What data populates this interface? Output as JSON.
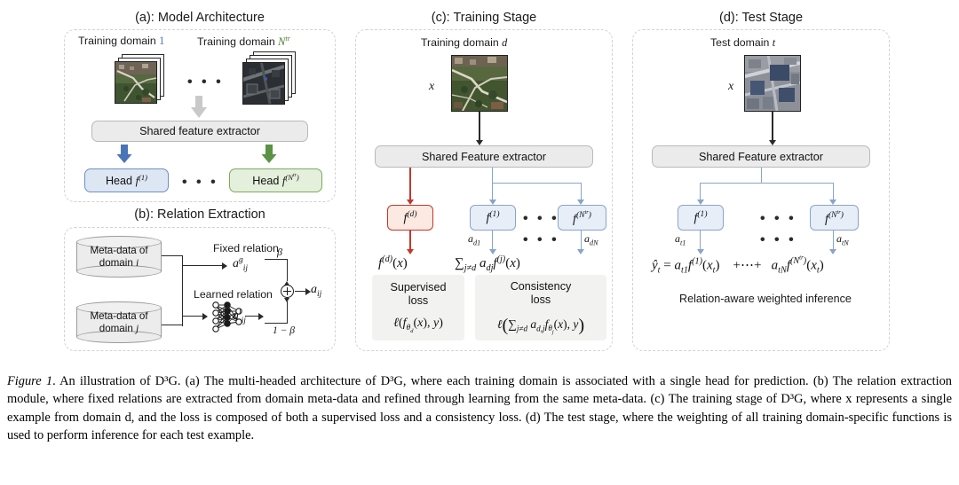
{
  "figure": {
    "panels": [
      {
        "id": "a",
        "title": "(a): Model Architecture",
        "domain_left_label": "Training domain",
        "domain_left_index": "1",
        "domain_right_label": "Training domain",
        "domain_right_index": "N",
        "domain_right_sup": "tr",
        "extractor_label": "Shared feature extractor",
        "head_left_prefix": "Head",
        "head_left_fn": "f",
        "head_left_sup": "(1)",
        "head_right_prefix": "Head",
        "head_right_fn": "f",
        "head_right_sup": "(N",
        "head_right_sup2": "tr",
        "head_right_sup3": ")",
        "ellipsis": "• • •"
      },
      {
        "id": "b",
        "title": "(b): Relation Extraction",
        "db_top_line1": "Meta-data of",
        "db_top_line2": "domain i",
        "db_bottom_line1": "Meta-data of",
        "db_bottom_line2": "domain j",
        "fixed_relation": "Fixed relation",
        "learned_relation": "Learned relation",
        "a_fixed": "a",
        "a_fixed_sup": "g",
        "a_fixed_sub": "ij",
        "a_learned": "a",
        "a_learned_sup": "l",
        "a_learned_sub": "ij",
        "beta": "β",
        "one_minus_beta": "1 − β",
        "a_out": "a",
        "a_out_sub": "ij"
      },
      {
        "id": "c",
        "title": "(c): Training Stage",
        "domain_label": "Training domain",
        "domain_index": "d",
        "input_label": "x",
        "extractor_label": "Shared Feature extractor",
        "head_d": "f",
        "head_d_sup": "(d)",
        "head_1": "f",
        "head_1_sup": "(1)",
        "head_N": "f",
        "head_N_sup": "(N",
        "head_N_sup2": "tr",
        "head_N_sup3": ")",
        "weight_left": "a",
        "weight_left_sub": "d1",
        "weight_right": "a",
        "weight_right_sub": "dN",
        "out_left": "f⁽ᵈ⁾(x)",
        "out_right": "∑ⱼ≠ᵈ aₑⱼ f⁽ʲ⁾(x)",
        "supervised_loss_title_line1": "Supervised",
        "supervised_loss_title_line2": "loss",
        "consistency_loss_title_line1": "Consistency",
        "consistency_loss_title_line2": "loss",
        "supervised_loss_formula": "ℓ(f_{θ_d}(x), y)",
        "consistency_loss_formula": "ℓ(∑_{j≠d} a_{d,j} f_{θ_j}(x), y)",
        "ellipsis": "• • •"
      },
      {
        "id": "d",
        "title": "(d): Test Stage",
        "domain_label": "Test domain",
        "domain_index": "t",
        "input_label": "x",
        "extractor_label": "Shared Feature extractor",
        "head_1": "f",
        "head_1_sup": "(1)",
        "head_N": "f",
        "head_N_sup": "(N",
        "head_N_sup2": "tr",
        "head_N_sup3": ")",
        "weight_left": "a",
        "weight_left_sub": "t1",
        "weight_right": "a",
        "weight_right_sub": "tN",
        "inference_formula": "ŷ_t = a_{t1} f^{(1)}(x_t)  + ··· +  a_{tN} f^{(N^{tr})}(x_t)",
        "inference_caption": "Relation-aware weighted inference",
        "ellipsis": "• • •"
      }
    ]
  },
  "caption": {
    "prefix": "Figure 1",
    "text": ". An illustration of D³G. (a) The multi-headed architecture of D³G, where each training domain is associated with a single head for prediction. (b) The relation extraction module, where fixed relations are extracted from domain meta-data and refined through learning from the same meta-data. (c) The training stage of D³G, where x represents a single example from domain d, and the loss is composed of both a supervised loss and a consistency loss. (d) The test stage, where the weighting of all training domain-specific functions is used to perform inference for each test example."
  },
  "colors": {
    "blue_accent": "#4a74b8",
    "green_accent": "#4e7d32",
    "red_accent": "#c0392b",
    "gray_panel": "#d3d3d3",
    "light_blue_fill": "#dde6f3",
    "light_green_fill": "#e4efdc",
    "light_gray_fill": "#ebebeb"
  }
}
